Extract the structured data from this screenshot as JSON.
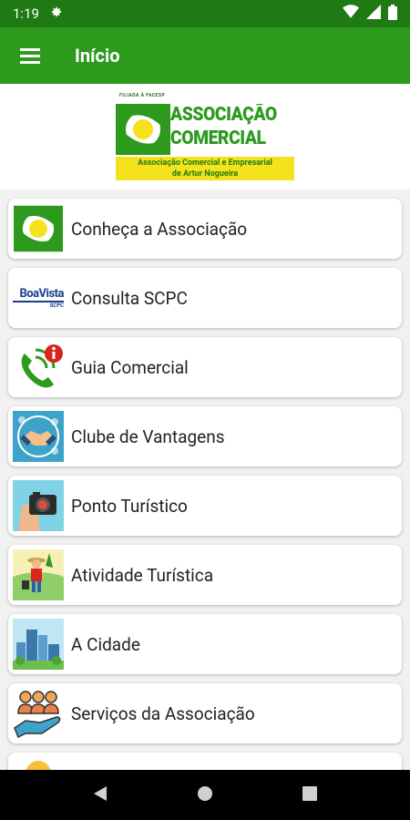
{
  "status": {
    "time": "1:19"
  },
  "appbar": {
    "title": "Início"
  },
  "logo": {
    "top_text": "FILIADA À FACESP",
    "line1": "ASSOCIAÇÃO",
    "line2": "COMERCIAL",
    "subtitle1": "Associação Comercial e Empresarial",
    "subtitle2": "de Artur Nogueira"
  },
  "menu_items": [
    {
      "label": "Conheça a Associação",
      "icon": "association-logo-icon"
    },
    {
      "label": "Consulta SCPC",
      "icon": "boavista-scpc-icon",
      "icon_text": "BoaVista",
      "icon_sub": "SCPC"
    },
    {
      "label": "Guia Comercial",
      "icon": "phone-info-icon"
    },
    {
      "label": "Clube de Vantagens",
      "icon": "handshake-icon"
    },
    {
      "label": "Ponto Turístico",
      "icon": "camera-icon"
    },
    {
      "label": "Atividade Turística",
      "icon": "tourist-icon"
    },
    {
      "label": "A Cidade",
      "icon": "city-icon"
    },
    {
      "label": "Serviços da Associação",
      "icon": "people-hand-icon"
    }
  ]
}
